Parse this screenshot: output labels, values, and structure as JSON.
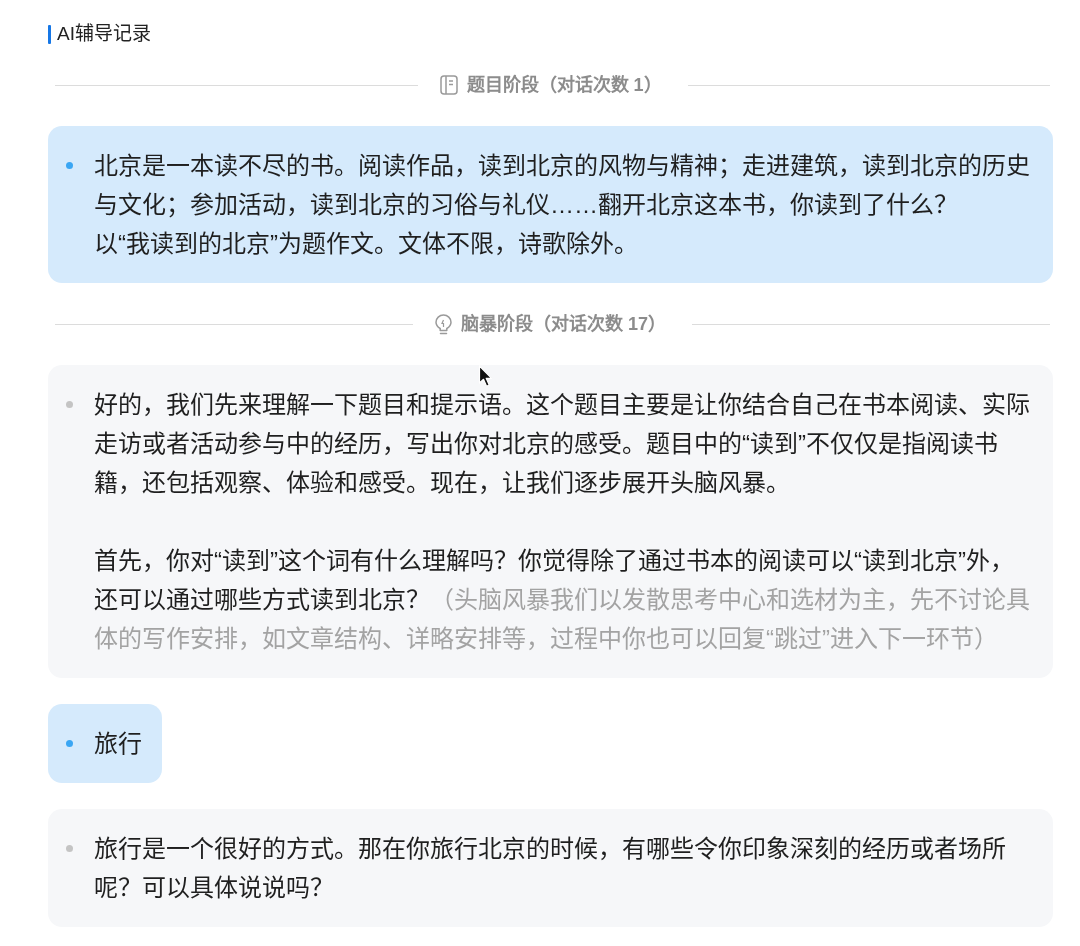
{
  "record": {
    "title": "AI辅导记录"
  },
  "stages": [
    {
      "kind": "topic",
      "label": "题目阶段（对话次数 1）",
      "messages": [
        {
          "kind": "user",
          "paragraphs": [
            {
              "lines": [
                {
                  "text": "北京是一本读不尽的书。阅读作品，读到北京的风物与精神；走进建筑，读到北京的历史与文化；参加活动，读到北京的习俗与礼仪……翻开北京这本书，你读到了什么？"
                },
                {
                  "text": "以“我读到的北京”为题作文。文体不限，诗歌除外。"
                }
              ]
            }
          ]
        }
      ]
    },
    {
      "kind": "brainstorm",
      "label": "脑暴阶段（对话次数 17）",
      "messages": [
        {
          "kind": "assistant",
          "paragraphs": [
            {
              "lines": [
                {
                  "text": "好的，我们先来理解一下题目和提示语。这个题目主要是让你结合自己在书本阅读、实际走访或者活动参与中的经历，写出你对北京的感受。题目中的“读到”不仅仅是指阅读书籍，还包括观察、体验和感受。现在，让我们逐步展开头脑风暴。"
                }
              ]
            },
            {
              "lines": [
                {
                  "text": "首先，你对“读到”这个词有什么理解吗？你觉得除了通过书本的阅读可以“读到北京”外，还可以通过哪些方式读到北京？",
                  "note": "（头脑风暴我们以发散思考中心和选材为主，先不讨论具体的写作安排，如文章结构、详略安排等，过程中你也可以回复“跳过”进入下一环节）"
                }
              ]
            }
          ]
        },
        {
          "kind": "user",
          "paragraphs": [
            {
              "lines": [
                {
                  "text": "旅行"
                }
              ]
            }
          ]
        },
        {
          "kind": "assistant",
          "paragraphs": [
            {
              "lines": [
                {
                  "text": "旅行是一个很好的方式。那在你旅行北京的时候，有哪些令你印象深刻的经历或者场所呢？可以具体说说吗？"
                }
              ]
            }
          ]
        }
      ]
    }
  ]
}
